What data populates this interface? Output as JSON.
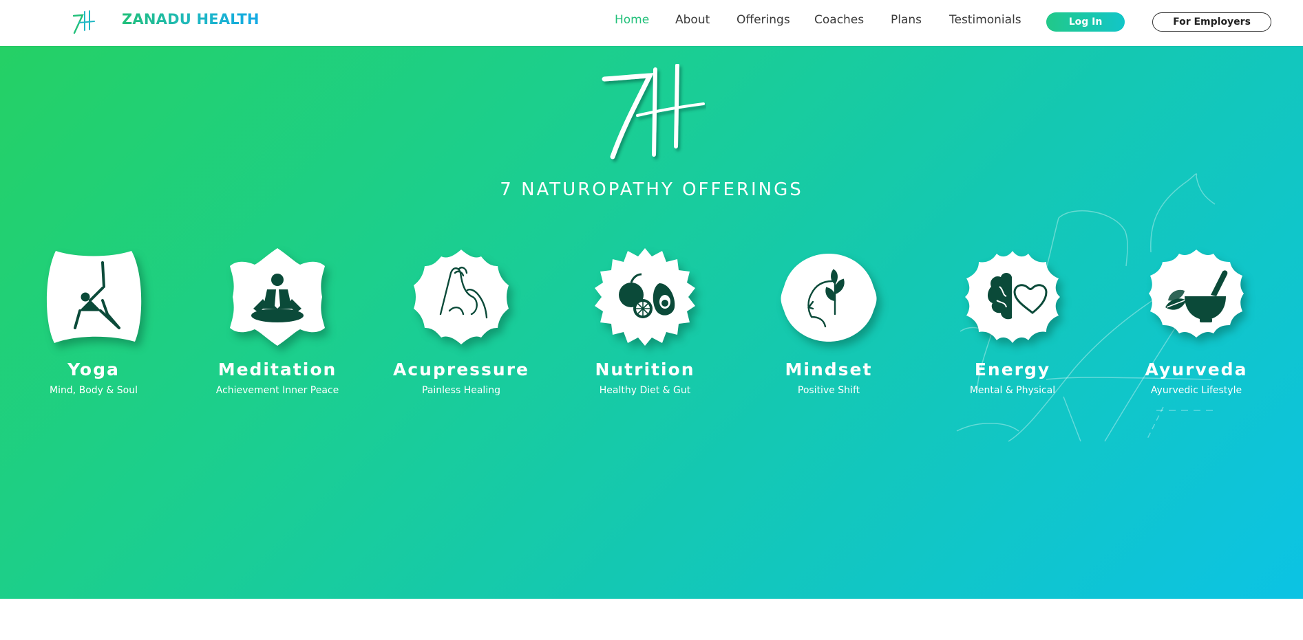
{
  "header": {
    "brand": "ZANADU HEALTH",
    "nav": [
      "Home",
      "About",
      "Offerings",
      "Coaches",
      "Plans",
      "Testimonials"
    ],
    "active": "Home",
    "login_label": "Log In",
    "employers_label": "For Employers"
  },
  "hero": {
    "title": "7 NATUROPATHY OFFERINGS",
    "offerings": [
      {
        "name": "Yoga",
        "subtitle": "Mind, Body & Soul",
        "icon": "yoga-icon"
      },
      {
        "name": "Meditation",
        "subtitle": "Achievement Inner Peace",
        "icon": "meditation-icon"
      },
      {
        "name": "Acupressure",
        "subtitle": "Painless Healing",
        "icon": "acupressure-icon"
      },
      {
        "name": "Nutrition",
        "subtitle": "Healthy Diet & Gut",
        "icon": "nutrition-icon"
      },
      {
        "name": "Mindset",
        "subtitle": "Positive Shift",
        "icon": "mindset-icon"
      },
      {
        "name": "Energy",
        "subtitle": "Mental & Physical",
        "icon": "energy-icon"
      },
      {
        "name": "Ayurveda",
        "subtitle": "Ayurvedic Lifestyle",
        "icon": "ayurveda-icon"
      }
    ]
  },
  "colors": {
    "brand_green": "#22c07a",
    "hero_gradient_start": "#25d065",
    "hero_gradient_end": "#0cc3e4",
    "icon_dark": "#0b4a39"
  }
}
